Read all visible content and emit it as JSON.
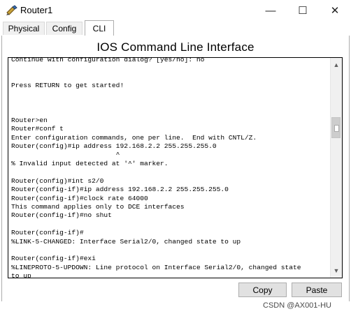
{
  "window": {
    "title": "Router1"
  },
  "window_buttons": {
    "minimize": "—",
    "maximize": "☐",
    "close": "✕"
  },
  "tabs": [
    {
      "label": "Physical",
      "selected": false
    },
    {
      "label": "Config",
      "selected": false
    },
    {
      "label": "CLI",
      "selected": true
    }
  ],
  "cli": {
    "heading": "IOS Command Line Interface",
    "console_text": "Continue with configuration dialog? [yes/no]: no\n\n\nPress RETURN to get started!\n\n\n\nRouter>en\nRouter#conf t\nEnter configuration commands, one per line.  End with CNTL/Z.\nRouter(config)#ip address 192.168.2.2 255.255.255.0\n                          ^\n% Invalid input detected at '^' marker.\n\nRouter(config)#int s2/0\nRouter(config-if)#ip address 192.168.2.2 255.255.255.0\nRouter(config-if)#clock rate 64000\nThis command applies only to DCE interfaces\nRouter(config-if)#no shut\n\nRouter(config-if)#\n%LINK-5-CHANGED: Interface Serial2/0, changed state to up\n\nRouter(config-if)#exi\n%LINEPROTO-5-UPDOWN: Line protocol on Interface Serial2/0, changed state\nto up"
  },
  "buttons": {
    "copy": "Copy",
    "paste": "Paste"
  },
  "watermark": "CSDN @AX001-HU",
  "colors": {
    "border": "#adadad",
    "button_bg": "#e1e1e1",
    "scroll_bg": "#f0f0f0"
  }
}
